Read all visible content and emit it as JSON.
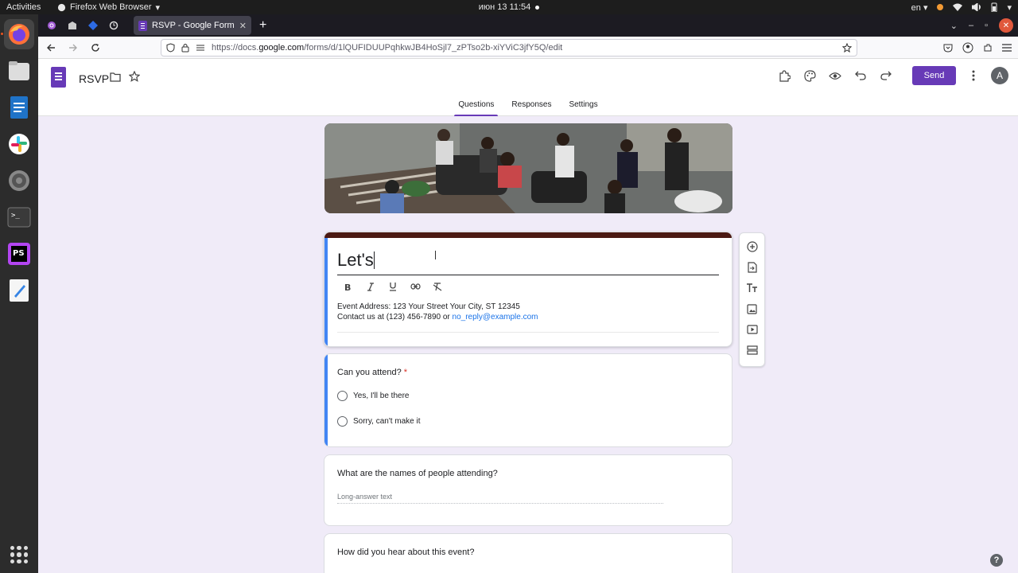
{
  "system_bar": {
    "activities": "Activities",
    "app_name": "Firefox Web Browser",
    "clock": "июн 13  11:54",
    "language": "en"
  },
  "browser": {
    "tab_title": "RSVP - Google Forms",
    "url_prefix": "https://docs.",
    "url_domain": "google.com",
    "url_path": "/forms/d/1lQUFIDUUPqhkwJB4HoSjl7_zPTso2b-xiYViC3jfY5Q/edit"
  },
  "forms_header": {
    "doc_title": "RSVP",
    "send_label": "Send",
    "avatar_letter": "A",
    "tabs": [
      {
        "label": "Questions",
        "active": true
      },
      {
        "label": "Responses",
        "active": false
      },
      {
        "label": "Settings",
        "active": false
      }
    ]
  },
  "form": {
    "title_value": "Let's",
    "description_line1": "Event Address: 123 Your Street Your City, ST 12345",
    "description_line2_prefix": "Contact us at (123) 456-7890 or ",
    "description_email": "no_reply@example.com",
    "questions": [
      {
        "title": "Can you attend?",
        "required_mark": "*",
        "options": [
          "Yes,  I'll be there",
          "Sorry, can't make it"
        ]
      },
      {
        "title": "What are the names of people attending?",
        "placeholder": "Long-answer text"
      },
      {
        "title": "How did you hear about this event?"
      }
    ]
  },
  "colors": {
    "brand_purple": "#673ab7",
    "title_stripe": "#4b1913",
    "focus_blue": "#4285f4"
  }
}
